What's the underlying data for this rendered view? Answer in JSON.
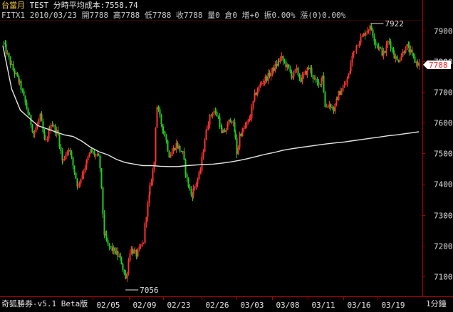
{
  "header": {
    "symbol": "台當月",
    "account": "TEST",
    "cost_label": "分時平均成本:7558.74",
    "line2_code": "FITX1",
    "line2_date": "2010/03/23",
    "line2_open": "開7788",
    "line2_high": "高7788",
    "line2_low": "低7788",
    "line2_close": "收7788",
    "line2_vol": "量0",
    "line2_oi": "倉0",
    "line2_chg": "增+0",
    "line2_amp": "振0.00%",
    "line2_pct": "漲(0)0.00%"
  },
  "footer": {
    "brand": "奇狐勝券-v5.1 Beta版",
    "period": "1分鐘"
  },
  "colors": {
    "up": "#ff3030",
    "down": "#22cc22",
    "average": "#e6e6e6",
    "axis": "#b00000",
    "last_tag_bg": "#ffffff",
    "last_tag_text": "#ff2020"
  },
  "chart_data": {
    "type": "candlestick",
    "ylim": [
      7040,
      7960
    ],
    "y_ticks": [
      7100,
      7200,
      7300,
      7400,
      7500,
      7600,
      7700,
      7800,
      7900
    ],
    "x_ticks": [
      "02/05",
      "02/09",
      "02/23",
      "02/26",
      "03/03",
      "03/08",
      "03/11",
      "03/16",
      "03/19"
    ],
    "annotations": {
      "high": "7922",
      "low": "7056",
      "last": "7788"
    },
    "price_path": [
      [
        0,
        7860
      ],
      [
        4,
        7780
      ],
      [
        8,
        7720
      ],
      [
        11,
        7640
      ],
      [
        14,
        7560
      ],
      [
        17,
        7620
      ],
      [
        19,
        7530
      ],
      [
        22,
        7600
      ],
      [
        25,
        7560
      ],
      [
        27,
        7470
      ],
      [
        30,
        7520
      ],
      [
        34,
        7390
      ],
      [
        37,
        7450
      ],
      [
        40,
        7510
      ],
      [
        44,
        7480
      ],
      [
        46,
        7240
      ],
      [
        48,
        7200
      ],
      [
        51,
        7180
      ],
      [
        54,
        7150
      ],
      [
        56,
        7090
      ],
      [
        58,
        7190
      ],
      [
        61,
        7170
      ],
      [
        64,
        7210
      ],
      [
        65,
        7290
      ],
      [
        67,
        7380
      ],
      [
        69,
        7470
      ],
      [
        70,
        7660
      ],
      [
        72,
        7600
      ],
      [
        74,
        7560
      ],
      [
        76,
        7490
      ],
      [
        79,
        7530
      ],
      [
        82,
        7500
      ],
      [
        84,
        7410
      ],
      [
        86,
        7360
      ],
      [
        88,
        7400
      ],
      [
        90,
        7440
      ],
      [
        92,
        7550
      ],
      [
        94,
        7610
      ],
      [
        96,
        7640
      ],
      [
        98,
        7620
      ],
      [
        100,
        7560
      ],
      [
        102,
        7580
      ],
      [
        104,
        7620
      ],
      [
        106,
        7560
      ],
      [
        107,
        7490
      ],
      [
        108,
        7560
      ],
      [
        110,
        7580
      ],
      [
        113,
        7620
      ],
      [
        115,
        7690
      ],
      [
        118,
        7730
      ],
      [
        121,
        7750
      ],
      [
        124,
        7780
      ],
      [
        127,
        7810
      ],
      [
        129,
        7790
      ],
      [
        132,
        7750
      ],
      [
        134,
        7770
      ],
      [
        136,
        7740
      ],
      [
        138,
        7760
      ],
      [
        140,
        7780
      ],
      [
        142,
        7740
      ],
      [
        144,
        7720
      ],
      [
        146,
        7760
      ],
      [
        147,
        7650
      ],
      [
        149,
        7660
      ],
      [
        151,
        7640
      ],
      [
        153,
        7690
      ],
      [
        156,
        7720
      ],
      [
        158,
        7760
      ],
      [
        160,
        7830
      ],
      [
        162,
        7860
      ],
      [
        164,
        7880
      ],
      [
        166,
        7900
      ],
      [
        168,
        7910
      ],
      [
        170,
        7860
      ],
      [
        172,
        7840
      ],
      [
        174,
        7820
      ],
      [
        176,
        7870
      ],
      [
        178,
        7830
      ],
      [
        180,
        7800
      ],
      [
        182,
        7820
      ],
      [
        184,
        7850
      ],
      [
        186,
        7830
      ],
      [
        188,
        7800
      ],
      [
        190,
        7788
      ]
    ],
    "average_path": [
      [
        0,
        7850
      ],
      [
        4,
        7710
      ],
      [
        8,
        7640
      ],
      [
        12,
        7615
      ],
      [
        16,
        7590
      ],
      [
        20,
        7580
      ],
      [
        24,
        7570
      ],
      [
        28,
        7560
      ],
      [
        32,
        7555
      ],
      [
        36,
        7540
      ],
      [
        40,
        7520
      ],
      [
        44,
        7505
      ],
      [
        48,
        7495
      ],
      [
        52,
        7480
      ],
      [
        56,
        7470
      ],
      [
        60,
        7465
      ],
      [
        64,
        7460
      ],
      [
        68,
        7460
      ],
      [
        72,
        7458
      ],
      [
        76,
        7457
      ],
      [
        80,
        7457
      ],
      [
        84,
        7460
      ],
      [
        88,
        7462
      ],
      [
        92,
        7464
      ],
      [
        96,
        7465
      ],
      [
        100,
        7468
      ],
      [
        104,
        7472
      ],
      [
        108,
        7477
      ],
      [
        112,
        7483
      ],
      [
        116,
        7490
      ],
      [
        120,
        7497
      ],
      [
        124,
        7503
      ],
      [
        128,
        7510
      ],
      [
        132,
        7515
      ],
      [
        136,
        7519
      ],
      [
        140,
        7523
      ],
      [
        144,
        7527
      ],
      [
        148,
        7531
      ],
      [
        152,
        7534
      ],
      [
        156,
        7537
      ],
      [
        160,
        7541
      ],
      [
        164,
        7545
      ],
      [
        168,
        7549
      ],
      [
        172,
        7553
      ],
      [
        176,
        7557
      ],
      [
        180,
        7560
      ],
      [
        184,
        7564
      ],
      [
        188,
        7568
      ],
      [
        190,
        7570
      ]
    ],
    "gaps_after": [
      44,
      64,
      82,
      106,
      146,
      156,
      178
    ]
  }
}
